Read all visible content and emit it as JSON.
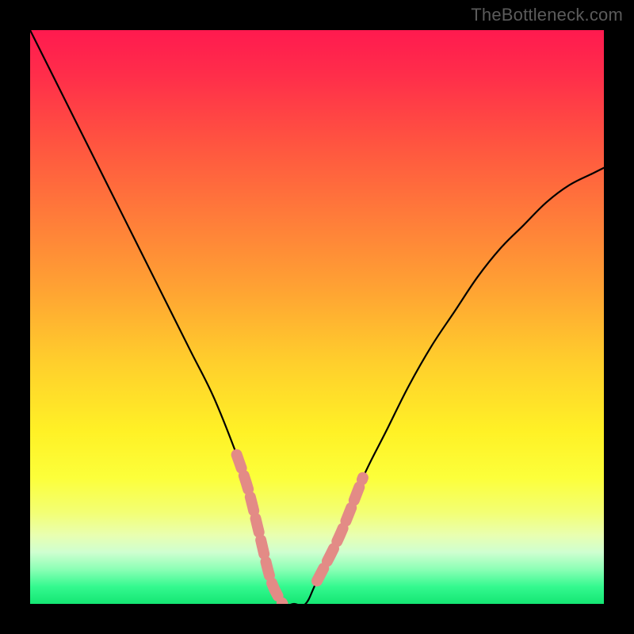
{
  "watermark": "TheBottleneck.com",
  "chart_data": {
    "type": "line",
    "title": "",
    "xlabel": "",
    "ylabel": "",
    "xlim": [
      0,
      100
    ],
    "ylim": [
      0,
      100
    ],
    "grid": false,
    "legend": false,
    "series": [
      {
        "name": "bottleneck-curve",
        "color": "#000000",
        "x": [
          0,
          4,
          8,
          12,
          16,
          20,
          24,
          28,
          32,
          36,
          38,
          40,
          42,
          44,
          46,
          48,
          50,
          54,
          58,
          62,
          66,
          70,
          74,
          78,
          82,
          86,
          90,
          94,
          98,
          100
        ],
        "y": [
          100,
          92,
          84,
          76,
          68,
          60,
          52,
          44,
          36,
          26,
          20,
          12,
          4,
          0,
          0,
          0,
          4,
          12,
          22,
          30,
          38,
          45,
          51,
          57,
          62,
          66,
          70,
          73,
          75,
          76
        ]
      }
    ],
    "highlight_segments": [
      {
        "name": "left-dash-segment",
        "color": "#e38b86",
        "width": 14,
        "dash": [
          18,
          10
        ],
        "points_index_range": [
          9,
          13
        ]
      },
      {
        "name": "right-dash-segment",
        "color": "#e38b86",
        "width": 14,
        "dash": [
          18,
          10
        ],
        "points_index_range": [
          16,
          18
        ]
      }
    ],
    "background_gradient": {
      "stops": [
        {
          "pos": 0.0,
          "color": "#ff1a4f"
        },
        {
          "pos": 0.2,
          "color": "#ff5540"
        },
        {
          "pos": 0.45,
          "color": "#ffa233"
        },
        {
          "pos": 0.7,
          "color": "#fff126"
        },
        {
          "pos": 0.88,
          "color": "#e9ffb0"
        },
        {
          "pos": 1.0,
          "color": "#14e673"
        }
      ]
    }
  }
}
